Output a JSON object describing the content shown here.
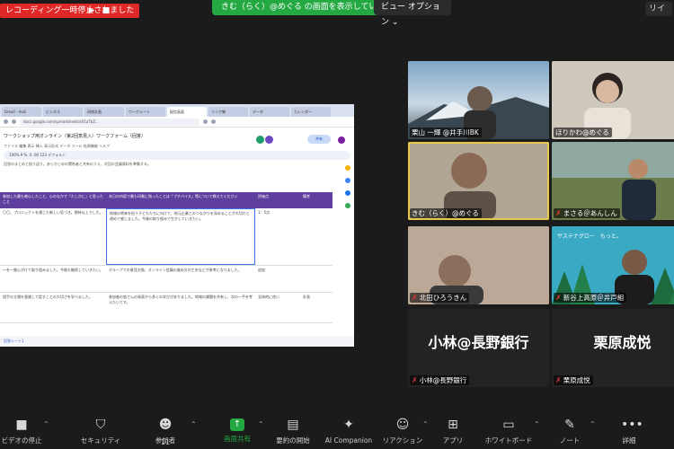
{
  "topbar": {
    "recording_status": "レコーディング一時停止されました",
    "play_icon": "play-icon",
    "stop_icon": "stop-icon",
    "share_banner": "きむ（らく）@めぐる の画面を表示しています",
    "view_options": "ビュー オプション",
    "right_label": "リイ"
  },
  "shared_screen": {
    "tabs": [
      "Gmail - mail",
      "ビジネス",
      "研修計画",
      "ワークシート",
      "配信画面",
      "リンク集",
      "データ",
      "カレンダー"
    ],
    "url": "docs.google.com/spreadsheets/d/1aTbZ...",
    "form_title": "ワークショップ用オンライン（第2回意見入）ワークフォーム（回答）",
    "menu": "ファイル 編集 表示 挿入 表示形式 データ ツール 拡張機能 ヘルプ",
    "share_button": "共有",
    "toolbar_text": "100%  ¥  %  .0  .00  123  デフォルト",
    "description": "回答のまとめと振り返り。あらかじめの関係者と共有のうえ、次回の会議資料を準備する。",
    "headers": [
      "参加した最も感心したこと、心のなかで「たしかに」と思ったこと",
      "本日の内容で最も印象に残ったことは「プチバイス」等について教えてください",
      "評価点",
      "備考"
    ],
    "rows": [
      [
        "〇〇、プロジェクトを通じた新しい気づき。期待以上でした。",
        "地域の将来を担う子どもたちに向けて、地元企業とのつながりを深めることが大切だと改めて感じました。今後の取り組みで生かしていきたい。",
        "1：5点",
        ""
      ],
      [
        "〜を一層心がけて取り組みました。今後も継続していきたい。",
        "グループでの意見交換、オンライン会議の進め方の工夫などが参考になりました。",
        "追加",
        ""
      ],
      [
        "相手の立場を意識して話すことの大切さを学べました。",
        "参加者の皆さんの発表から多くの学びがありました。地域の課題を共有し、次の一手を考えたいです。",
        "全体的に良い",
        "計画"
      ]
    ],
    "footer": "回答シート1"
  },
  "participants": [
    {
      "name": "栗山 一輝 @井手川BK",
      "muted": false
    },
    {
      "name": "ほりかわ@めぐる",
      "muted": false
    },
    {
      "name": "きむ（らく）@めぐる",
      "muted": false
    },
    {
      "name": "まさる＠あんしん",
      "muted": true
    },
    {
      "name": "北田ひろうきん",
      "muted": true
    },
    {
      "name": "新谷上高原＠井戸組",
      "muted": true
    },
    {
      "name": "小林@長野銀行",
      "muted": true,
      "display": "小林@長野銀行"
    },
    {
      "name": "栗原成悦",
      "muted": true,
      "display": "栗原成悦"
    }
  ],
  "tile_banner_text": "サステナグロー　もっと。",
  "toolbar": {
    "video": "ビデオの停止",
    "security": "セキュリティ",
    "participants": "参加者",
    "participants_count": "11",
    "share": "画面共有",
    "summary": "要約の開始",
    "ai": "AI Companion",
    "reactions": "リアクション",
    "apps": "アプリ",
    "whiteboard": "ホワイトボード",
    "notes": "ノート",
    "more": "詳細"
  },
  "colors": {
    "recording_red": "#e02828",
    "share_green": "#23a842",
    "sheet_header_purple": "#5f3f9e",
    "speaking_border": "#e8c84a"
  }
}
